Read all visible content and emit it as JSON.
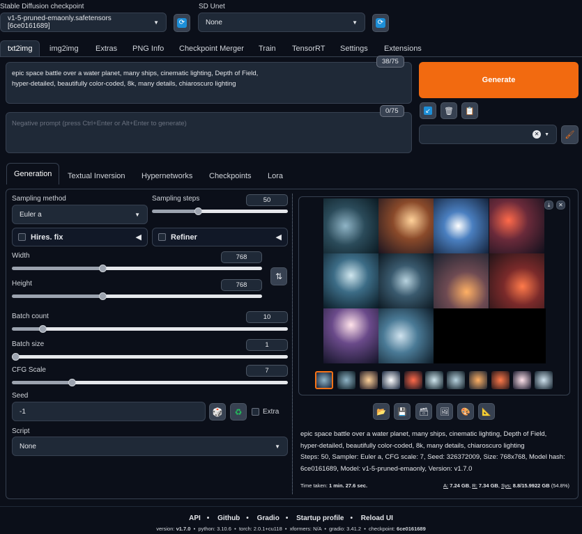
{
  "top": {
    "checkpoint_label": "Stable Diffusion checkpoint",
    "checkpoint_value": "v1-5-pruned-emaonly.safetensors [6ce0161689]",
    "unet_label": "SD Unet",
    "unet_value": "None"
  },
  "tabs": [
    "txt2img",
    "img2img",
    "Extras",
    "PNG Info",
    "Checkpoint Merger",
    "Train",
    "TensorRT",
    "Settings",
    "Extensions"
  ],
  "prompt": {
    "text_line1": "epic space battle over a water planet, many ships, cinematic lighting, Depth of Field,",
    "text_line2": "hyper-detailed, beautifully color-coded, 8k, many details, chiaroscuro lighting",
    "counter": "38/75",
    "negative_placeholder": "Negative prompt (press Ctrl+Enter or Alt+Enter to generate)",
    "negative_counter": "0/75"
  },
  "generate_label": "Generate",
  "subtabs": [
    "Generation",
    "Textual Inversion",
    "Hypernetworks",
    "Checkpoints",
    "Lora"
  ],
  "params": {
    "sampling_method_label": "Sampling method",
    "sampling_method": "Euler a",
    "sampling_steps_label": "Sampling steps",
    "sampling_steps": 50,
    "hires_label": "Hires. fix",
    "refiner_label": "Refiner",
    "width_label": "Width",
    "width": 768,
    "height_label": "Height",
    "height": 768,
    "batch_count_label": "Batch count",
    "batch_count": 10,
    "batch_size_label": "Batch size",
    "batch_size": 1,
    "cfg_label": "CFG Scale",
    "cfg": 7,
    "seed_label": "Seed",
    "seed": "-1",
    "extra_label": "Extra",
    "script_label": "Script",
    "script": "None"
  },
  "slider_fractions": {
    "sampling_steps": 0.33,
    "width": 0.36,
    "height": 0.36,
    "batch_count": 0.1,
    "batch_size": 0.0,
    "cfg": 0.21
  },
  "output": {
    "info_line1": "epic space battle over a water planet, many ships, cinematic lighting, Depth of Field,",
    "info_line2": "hyper-detailed, beautifully color-coded, 8k, many details, chiaroscuro lighting",
    "info_line3": "Steps: 50, Sampler: Euler a, CFG scale: 7, Seed: 326372009, Size: 768x768, Model hash:",
    "info_line4": "6ce0161689, Model: v1-5-pruned-emaonly, Version: v1.7.0",
    "time_label": "Time taken:",
    "time_value": "1 min. 27.6 sec.",
    "mem_a_label": "A:",
    "mem_a": "7.24 GB",
    "mem_r_label": "R:",
    "mem_r": "7.34 GB",
    "mem_sys_label": "Sys:",
    "mem_sys": "8.8/15.9922 GB",
    "mem_pct": "(54.8%)"
  },
  "footer": {
    "links": [
      "API",
      "Github",
      "Gradio",
      "Startup profile",
      "Reload UI"
    ],
    "version_label": "version:",
    "version": "v1.7.0",
    "python_label": "python:",
    "python": "3.10.6",
    "torch_label": "torch:",
    "torch": "2.0.1+cu118",
    "xformers_label": "xformers:",
    "xformers": "N/A",
    "gradio_label": "gradio:",
    "gradio": "3.41.2",
    "checkpoint_label": "checkpoint:",
    "checkpoint": "6ce0161689"
  },
  "colors": {
    "background": "#0b0f19",
    "generate": "#f26a10",
    "thumbnail_selected": "#f97316"
  }
}
